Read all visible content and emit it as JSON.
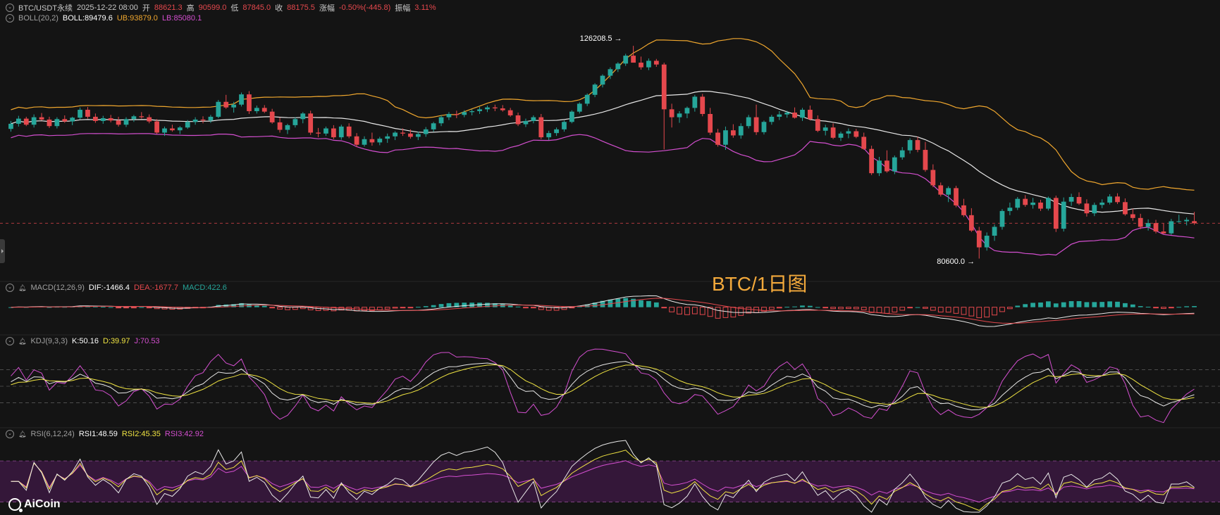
{
  "header": {
    "symbol": "BTC/USDT永续",
    "datetime": "2025-12-22 08:00",
    "open_label": "开",
    "open": "88621.3",
    "high_label": "高",
    "high": "90599.0",
    "low_label": "低",
    "low": "87845.0",
    "close_label": "收",
    "close": "88175.5",
    "change_label": "涨幅",
    "change": "-0.50%(-445.8)",
    "amp_label": "振幅",
    "amp": "3.11%"
  },
  "boll": {
    "name": "BOLL(20,2)",
    "mid": "BOLL:89479.6",
    "ub": "UB:93879.0",
    "lb": "LB:85080.1"
  },
  "macd": {
    "name": "MACD(12,26,9)",
    "dif": "DIF:-1466.4",
    "dea": "DEA:-1677.7",
    "macd": "MACD:422.6"
  },
  "kdj": {
    "name": "KDJ(9,3,3)",
    "k": "K:50.16",
    "d": "D:39.97",
    "j": "J:70.53"
  },
  "rsi": {
    "name": "RSI(6,12,24)",
    "rsi1": "RSI1:48.59",
    "rsi2": "RSI2:45.35",
    "rsi3": "RSI3:42.92"
  },
  "annotations": {
    "high": "126208.5 →",
    "low": "80600.0 →"
  },
  "watermark": "BTC/1日图",
  "logo": "AiCoin",
  "colors": {
    "up": "#26a69a",
    "down": "#e5484d",
    "mid": "#e8e8e8",
    "ub": "#f0a72e",
    "lb": "#d44fd0",
    "dif": "#e8e8e8",
    "dea": "#e5484d",
    "k": "#e8e8e8",
    "d": "#f0e442",
    "j": "#d44fd0",
    "rsi1": "#e8e8e8",
    "rsi2": "#f0e442",
    "rsi3": "#d44fd0"
  },
  "chart_data": {
    "type": "candlestick",
    "description_free": "",
    "candles": [
      [
        108400,
        110100,
        107800,
        109500
      ],
      [
        109500,
        111200,
        108900,
        110600
      ],
      [
        110600,
        111000,
        109000,
        109300
      ],
      [
        109300,
        111500,
        108700,
        110900
      ],
      [
        110900,
        111800,
        110200,
        110400
      ],
      [
        110400,
        111000,
        108600,
        109000
      ],
      [
        109000,
        110900,
        108500,
        110500
      ],
      [
        110500,
        111300,
        109700,
        110000
      ],
      [
        110000,
        111000,
        109200,
        110800
      ],
      [
        110800,
        113000,
        110400,
        112500
      ],
      [
        112500,
        113100,
        110600,
        111000
      ],
      [
        111000,
        111700,
        109700,
        110100
      ],
      [
        110100,
        111200,
        109500,
        110700
      ],
      [
        110700,
        111400,
        109800,
        110200
      ],
      [
        110200,
        111000,
        108900,
        109300
      ],
      [
        109300,
        110900,
        108800,
        110500
      ],
      [
        110500,
        111400,
        109900,
        111100
      ],
      [
        111100,
        112000,
        110600,
        110900
      ],
      [
        110900,
        111500,
        109600,
        110000
      ],
      [
        110000,
        110500,
        107300,
        107600
      ],
      [
        107600,
        108900,
        106900,
        108500
      ],
      [
        108500,
        109300,
        107800,
        108100
      ],
      [
        108100,
        109000,
        107300,
        108700
      ],
      [
        108700,
        110300,
        108400,
        109900
      ],
      [
        109900,
        110900,
        109300,
        110400
      ],
      [
        110400,
        111100,
        109600,
        110200
      ],
      [
        110200,
        111400,
        109700,
        111000
      ],
      [
        111000,
        114600,
        110700,
        114200
      ],
      [
        114200,
        115700,
        112700,
        113000
      ],
      [
        113000,
        114200,
        111900,
        113600
      ],
      [
        113600,
        116200,
        113200,
        115800
      ],
      [
        115800,
        116500,
        111600,
        112200
      ],
      [
        112200,
        113400,
        111700,
        112900
      ],
      [
        112900,
        113500,
        111800,
        112100
      ],
      [
        112100,
        112700,
        109500,
        109800
      ],
      [
        109800,
        110800,
        107600,
        108200
      ],
      [
        108200,
        109500,
        107300,
        109200
      ],
      [
        109200,
        110900,
        108700,
        110500
      ],
      [
        110500,
        112000,
        109600,
        111700
      ],
      [
        111700,
        112300,
        107100,
        107600
      ],
      [
        107600,
        108600,
        106600,
        107400
      ],
      [
        107400,
        108900,
        106900,
        108500
      ],
      [
        108500,
        109200,
        106200,
        106600
      ],
      [
        106600,
        109300,
        106100,
        108900
      ],
      [
        108900,
        109600,
        106400,
        106800
      ],
      [
        106800,
        107500,
        104500,
        105000
      ],
      [
        105000,
        106800,
        104600,
        106200
      ],
      [
        106200,
        107600,
        104800,
        105500
      ],
      [
        105500,
        106700,
        104900,
        106300
      ],
      [
        106300,
        107400,
        105400,
        106800
      ],
      [
        106800,
        107900,
        106000,
        107600
      ],
      [
        107600,
        108500,
        106900,
        107400
      ],
      [
        107400,
        108300,
        106300,
        106700
      ],
      [
        106700,
        107800,
        106000,
        107300
      ],
      [
        107300,
        108800,
        106700,
        108300
      ],
      [
        108300,
        109900,
        107800,
        109600
      ],
      [
        109600,
        111300,
        109000,
        110900
      ],
      [
        110900,
        112000,
        110300,
        111600
      ],
      [
        111600,
        112300,
        110700,
        111400
      ],
      [
        111400,
        112400,
        110900,
        112000
      ],
      [
        112000,
        112600,
        111300,
        112200
      ],
      [
        112200,
        113100,
        111600,
        112600
      ],
      [
        112600,
        113400,
        112000,
        113000
      ],
      [
        113000,
        113600,
        112200,
        112800
      ],
      [
        112800,
        113500,
        112100,
        112400
      ],
      [
        112400,
        112900,
        111000,
        111300
      ],
      [
        111300,
        111900,
        109000,
        109400
      ],
      [
        109400,
        110600,
        108800,
        110100
      ],
      [
        110100,
        111300,
        109600,
        110900
      ],
      [
        110900,
        111600,
        106200,
        106600
      ],
      [
        106600,
        108000,
        106000,
        107500
      ],
      [
        107500,
        108700,
        106900,
        108300
      ],
      [
        108300,
        110200,
        107800,
        109900
      ],
      [
        109900,
        112400,
        109600,
        112100
      ],
      [
        112100,
        114100,
        111700,
        113800
      ],
      [
        113800,
        116000,
        113300,
        115700
      ],
      [
        115700,
        118200,
        115200,
        117900
      ],
      [
        117900,
        120100,
        117300,
        119800
      ],
      [
        119800,
        121600,
        119100,
        121200
      ],
      [
        121200,
        122700,
        120600,
        122400
      ],
      [
        122400,
        124500,
        121900,
        124100
      ],
      [
        124100,
        126208.5,
        123400,
        122600
      ],
      [
        122600,
        123900,
        121100,
        121600
      ],
      [
        121600,
        123500,
        121000,
        123000
      ],
      [
        123000,
        123400,
        121700,
        122200
      ],
      [
        122200,
        122600,
        104000,
        112600
      ],
      [
        112600,
        113800,
        108700,
        110900
      ],
      [
        110900,
        112200,
        109700,
        111700
      ],
      [
        111700,
        113200,
        110700,
        112900
      ],
      [
        112900,
        115700,
        112100,
        115300
      ],
      [
        115300,
        115900,
        111100,
        111600
      ],
      [
        111600,
        112900,
        107100,
        107600
      ],
      [
        107600,
        108400,
        104600,
        105000
      ],
      [
        105000,
        108900,
        103900,
        108100
      ],
      [
        108100,
        109400,
        106500,
        107000
      ],
      [
        107000,
        109600,
        106300,
        109000
      ],
      [
        109000,
        111400,
        108500,
        110900
      ],
      [
        110900,
        113600,
        107100,
        107700
      ],
      [
        107700,
        110200,
        107200,
        109900
      ],
      [
        109900,
        111400,
        109300,
        111000
      ],
      [
        111000,
        112200,
        110300,
        111500
      ],
      [
        111500,
        112300,
        110800,
        111900
      ],
      [
        111900,
        113000,
        110600,
        110800
      ],
      [
        110800,
        112900,
        110100,
        112500
      ],
      [
        112500,
        113400,
        110200,
        110500
      ],
      [
        110500,
        111300,
        107700,
        108000
      ],
      [
        108000,
        109300,
        107000,
        108700
      ],
      [
        108700,
        109600,
        106200,
        106500
      ],
      [
        106500,
        107800,
        105800,
        107400
      ],
      [
        107400,
        108500,
        106400,
        107900
      ],
      [
        107900,
        108400,
        106400,
        106700
      ],
      [
        106700,
        107600,
        103900,
        104100
      ],
      [
        104100,
        104800,
        98500,
        98900
      ],
      [
        98900,
        102400,
        98300,
        101600
      ],
      [
        101600,
        103800,
        99000,
        99300
      ],
      [
        99300,
        102700,
        98700,
        102300
      ],
      [
        102300,
        104500,
        101800,
        103800
      ],
      [
        103800,
        106400,
        103100,
        106000
      ],
      [
        106000,
        106700,
        103400,
        103900
      ],
      [
        103900,
        105600,
        99200,
        99600
      ],
      [
        99600,
        100800,
        95900,
        96300
      ],
      [
        96300,
        96900,
        93900,
        94300
      ],
      [
        94300,
        96100,
        92700,
        95700
      ],
      [
        95700,
        96200,
        91600,
        92000
      ],
      [
        92000,
        93400,
        89500,
        89900
      ],
      [
        89900,
        91400,
        86300,
        86600
      ],
      [
        86600,
        87400,
        80600,
        83000
      ],
      [
        83000,
        86200,
        82300,
        85500
      ],
      [
        85500,
        87900,
        84400,
        87400
      ],
      [
        87400,
        91200,
        86800,
        90800
      ],
      [
        90800,
        92600,
        89900,
        91500
      ],
      [
        91500,
        93800,
        91000,
        93400
      ],
      [
        93400,
        94200,
        91700,
        92100
      ],
      [
        92100,
        93600,
        91300,
        92600
      ],
      [
        92600,
        93200,
        90800,
        91300
      ],
      [
        91300,
        93900,
        90900,
        93600
      ],
      [
        93600,
        94100,
        86300,
        87000
      ],
      [
        87000,
        93700,
        86400,
        92800
      ],
      [
        92800,
        94500,
        91900,
        93800
      ],
      [
        93800,
        94800,
        92100,
        92400
      ],
      [
        92400,
        93300,
        89600,
        90300
      ],
      [
        90300,
        92600,
        89700,
        92100
      ],
      [
        92100,
        93300,
        91400,
        92600
      ],
      [
        92600,
        94400,
        92200,
        93900
      ],
      [
        93900,
        94600,
        92300,
        92700
      ],
      [
        92700,
        93500,
        89800,
        90100
      ],
      [
        90100,
        91300,
        88700,
        89300
      ],
      [
        89300,
        90200,
        86900,
        87400
      ],
      [
        87400,
        89000,
        86600,
        88200
      ],
      [
        88200,
        88900,
        86000,
        86400
      ],
      [
        86400,
        88100,
        85900,
        86000
      ],
      [
        86000,
        89100,
        85700,
        88600
      ],
      [
        88600,
        90000,
        88300,
        88600
      ],
      [
        88600,
        89400,
        87700,
        88900
      ],
      [
        88621.3,
        90599.0,
        87845.0,
        88175.5
      ]
    ],
    "price_axis": [
      76000,
      130000
    ],
    "last_price": 88175.5,
    "annotated_high": 126208.5,
    "annotated_low": 80600.0,
    "macd_range": [
      -8000,
      4000
    ],
    "kdj_range": [
      -20,
      120
    ],
    "kdj_levels": [
      80,
      50,
      20
    ],
    "rsi_range": [
      20,
      90
    ],
    "rsi_levels": [
      70,
      30
    ]
  }
}
